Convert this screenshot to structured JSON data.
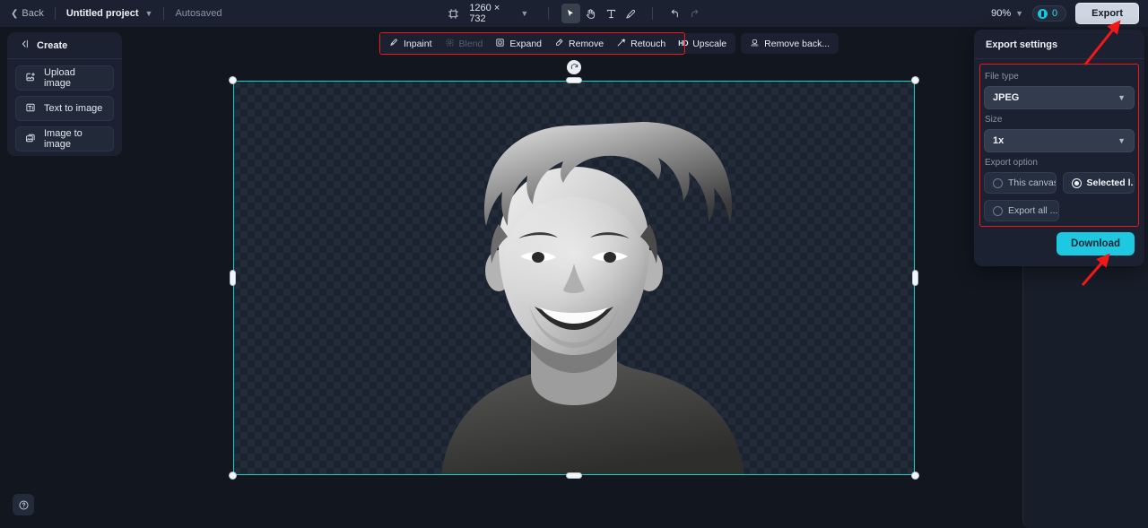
{
  "topbar": {
    "back_label": "Back",
    "project_name": "Untitled project",
    "autosave_status": "Autosaved",
    "canvas_size": "1260 × 732",
    "zoom_level": "90%",
    "credits_count": "0",
    "export_label": "Export",
    "tools": [
      {
        "name": "artboard-icon",
        "label": "Artboard"
      },
      {
        "name": "select-tool",
        "label": "Select"
      },
      {
        "name": "hand-tool",
        "label": "Hand"
      },
      {
        "name": "text-tool",
        "label": "Text"
      },
      {
        "name": "brush-tool",
        "label": "Brush"
      },
      {
        "name": "undo-button",
        "label": "Undo"
      },
      {
        "name": "redo-button",
        "label": "Redo"
      }
    ]
  },
  "left_panel": {
    "title": "Create",
    "items": [
      {
        "label": "Upload image",
        "icon": "upload-image-icon"
      },
      {
        "label": "Text to image",
        "icon": "text-to-image-icon"
      },
      {
        "label": "Image to image",
        "icon": "image-to-image-icon"
      }
    ]
  },
  "float_toolbar": {
    "group1": [
      {
        "label": "Inpaint",
        "icon": "inpaint-icon",
        "disabled": false
      },
      {
        "label": "Blend",
        "icon": "blend-icon",
        "disabled": true
      },
      {
        "label": "Expand",
        "icon": "expand-icon",
        "disabled": false
      },
      {
        "label": "Remove",
        "icon": "remove-icon",
        "disabled": false
      },
      {
        "label": "Retouch",
        "icon": "retouch-icon",
        "disabled": false
      },
      {
        "label": "Upscale",
        "icon": "upscale-icon",
        "badge": "HD",
        "disabled": false
      }
    ],
    "group2": [
      {
        "label": "Remove back...",
        "icon": "remove-background-icon",
        "disabled": false
      }
    ]
  },
  "export_panel": {
    "title": "Export settings",
    "file_type_label": "File type",
    "file_type_value": "JPEG",
    "size_label": "Size",
    "size_value": "1x",
    "export_option_label": "Export option",
    "options": [
      {
        "label": "This canvas",
        "selected": false
      },
      {
        "label": "Selected l...",
        "selected": true
      },
      {
        "label": "Export all ...",
        "selected": false
      }
    ],
    "download_label": "Download"
  },
  "canvas": {
    "artwork_description": "Black and white portrait of a smiling young man with curly hair, background removed",
    "selection_active": true
  },
  "colors": {
    "accent_cyan": "#1ec8e0",
    "selection_cyan": "#17d3c8",
    "annotation_red": "#f01818",
    "panel_bg": "#1b2130",
    "app_bg": "#12161f"
  },
  "help": {
    "label": "Help"
  }
}
